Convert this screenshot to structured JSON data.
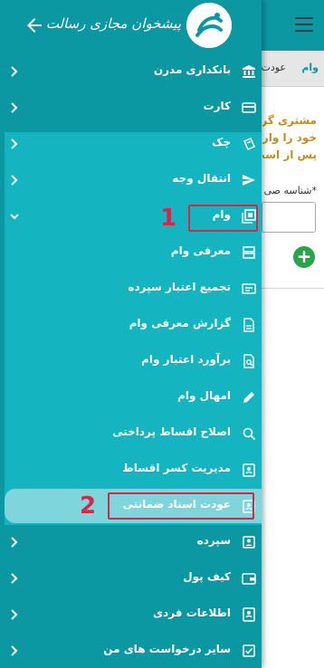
{
  "background": {
    "tabs": [
      "وام",
      "عودت"
    ],
    "notice_lines": [
      "مشتری گرا",
      "خود را وارد",
      "پس از است"
    ],
    "field_label": "*شناسه صی",
    "add_button": "+"
  },
  "drawer": {
    "brand_name": "پیشخوان مجازی رسالت",
    "menu": [
      {
        "label": "بانکداری مدرن",
        "icon": "bank-icon"
      },
      {
        "label": "کارت",
        "icon": "card-icon"
      },
      {
        "label": "چک",
        "icon": "check-icon"
      },
      {
        "label": "انتقال وجه",
        "icon": "send-icon"
      },
      {
        "label": "وام",
        "icon": "loan-icon"
      }
    ],
    "submenu": [
      {
        "label": "معرفی وام",
        "icon": "storage-icon"
      },
      {
        "label": "تجمیع اعتبار سپرده",
        "icon": "form-icon"
      },
      {
        "label": "گزارش معرفی وام",
        "icon": "document-icon"
      },
      {
        "label": "برآورد اعتبار وام",
        "icon": "file-search-icon"
      },
      {
        "label": "امهال وام",
        "icon": "pencil-icon"
      },
      {
        "label": "اصلاح اقساط پرداختی",
        "icon": "money-search-icon"
      },
      {
        "label": "مدیریت کسر اقساط",
        "icon": "id-badge-icon"
      },
      {
        "label": "عودت اسناد ضمانتی",
        "icon": "id-badge-icon"
      }
    ],
    "menu_after": [
      {
        "label": "سپرده",
        "icon": "account-box-icon"
      },
      {
        "label": "کیف پول",
        "icon": "wallet-icon"
      },
      {
        "label": "اطلاعات فردی",
        "icon": "profile-icon"
      },
      {
        "label": "سایر درخواست های من",
        "icon": "checkbox-icon"
      }
    ]
  },
  "annotations": {
    "step1": "1",
    "step2": "2"
  },
  "colors": {
    "primary": "#0b98a3",
    "submenu_bg": "#14b5c0",
    "selected": "#7ed6dc",
    "annotation": "#d2294b"
  }
}
